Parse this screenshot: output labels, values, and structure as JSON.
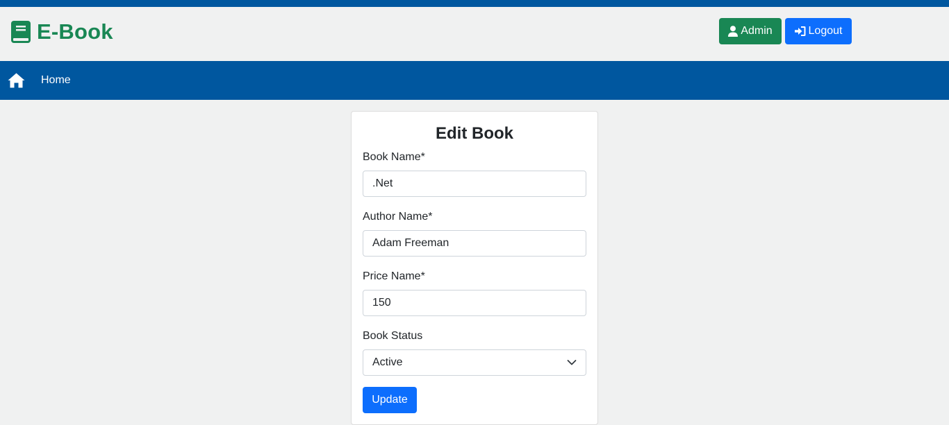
{
  "brand": {
    "title": "E-Book",
    "color": "#198754"
  },
  "header": {
    "admin_label": "Admin",
    "logout_label": "Logout"
  },
  "nav": {
    "home_label": "Home",
    "bar_color": "#00579f"
  },
  "form": {
    "title": "Edit Book",
    "book_name_label": "Book Name*",
    "book_name_value": ".Net",
    "author_name_label": "Author Name*",
    "author_name_value": "Adam Freeman",
    "price_label": "Price Name*",
    "price_value": "150",
    "status_label": "Book Status",
    "status_value": "Active",
    "update_label": "Update"
  },
  "icons": {
    "brand": "book-icon",
    "admin": "user-icon",
    "logout": "sign-in-icon",
    "home": "home-icon",
    "select": "chevron-down-icon"
  }
}
